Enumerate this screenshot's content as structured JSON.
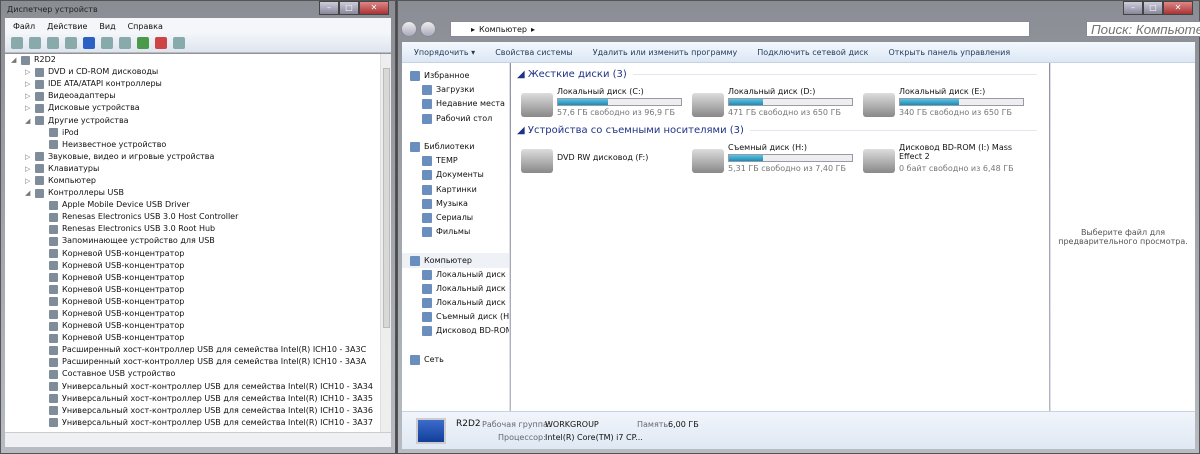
{
  "device_manager": {
    "title": "Диспетчер устройств",
    "menu": [
      "Файл",
      "Действие",
      "Вид",
      "Справка"
    ],
    "tree": [
      {
        "label": "R2D2",
        "level": 0,
        "arrow": "◢"
      },
      {
        "label": "DVD и CD-ROM дисководы",
        "level": 1,
        "arrow": "▷"
      },
      {
        "label": "IDE ATA/ATAPI контроллеры",
        "level": 1,
        "arrow": "▷"
      },
      {
        "label": "Видеоадаптеры",
        "level": 1,
        "arrow": "▷"
      },
      {
        "label": "Дисковые устройства",
        "level": 1,
        "arrow": "▷"
      },
      {
        "label": "Другие устройства",
        "level": 1,
        "arrow": "◢"
      },
      {
        "label": "iPod",
        "level": 2,
        "arrow": ""
      },
      {
        "label": "Неизвестное устройство",
        "level": 2,
        "arrow": ""
      },
      {
        "label": "Звуковые, видео и игровые устройства",
        "level": 1,
        "arrow": "▷"
      },
      {
        "label": "Клавиатуры",
        "level": 1,
        "arrow": "▷"
      },
      {
        "label": "Компьютер",
        "level": 1,
        "arrow": "▷"
      },
      {
        "label": "Контроллеры USB",
        "level": 1,
        "arrow": "◢"
      },
      {
        "label": "Apple Mobile Device USB Driver",
        "level": 2,
        "arrow": ""
      },
      {
        "label": "Renesas Electronics USB 3.0 Host Controller",
        "level": 2,
        "arrow": ""
      },
      {
        "label": "Renesas Electronics USB 3.0 Root Hub",
        "level": 2,
        "arrow": ""
      },
      {
        "label": "Запоминающее устройство для USB",
        "level": 2,
        "arrow": ""
      },
      {
        "label": "Корневой USB-концентратор",
        "level": 2,
        "arrow": ""
      },
      {
        "label": "Корневой USB-концентратор",
        "level": 2,
        "arrow": ""
      },
      {
        "label": "Корневой USB-концентратор",
        "level": 2,
        "arrow": ""
      },
      {
        "label": "Корневой USB-концентратор",
        "level": 2,
        "arrow": ""
      },
      {
        "label": "Корневой USB-концентратор",
        "level": 2,
        "arrow": ""
      },
      {
        "label": "Корневой USB-концентратор",
        "level": 2,
        "arrow": ""
      },
      {
        "label": "Корневой USB-концентратор",
        "level": 2,
        "arrow": ""
      },
      {
        "label": "Корневой USB-концентратор",
        "level": 2,
        "arrow": ""
      },
      {
        "label": "Расширенный хост-контроллер USB для семейства Intel(R) ICH10 - 3A3C",
        "level": 2,
        "arrow": ""
      },
      {
        "label": "Расширенный хост-контроллер USB для семейства Intel(R) ICH10 - 3A3A",
        "level": 2,
        "arrow": ""
      },
      {
        "label": "Составное USB устройство",
        "level": 2,
        "arrow": ""
      },
      {
        "label": "Универсальный хост-контроллер USB для семейства Intel(R) ICH10 - 3A34",
        "level": 2,
        "arrow": ""
      },
      {
        "label": "Универсальный хост-контроллер USB для семейства Intel(R) ICH10 - 3A35",
        "level": 2,
        "arrow": ""
      },
      {
        "label": "Универсальный хост-контроллер USB для семейства Intel(R) ICH10 - 3A36",
        "level": 2,
        "arrow": ""
      },
      {
        "label": "Универсальный хост-контроллер USB для семейства Intel(R) ICH10 - 3A37",
        "level": 2,
        "arrow": ""
      }
    ]
  },
  "explorer": {
    "breadcrumb": "Компьютер",
    "search_placeholder": "Поиск: Компьютер",
    "commands": [
      "Упорядочить ▾",
      "Свойства системы",
      "Удалить или изменить программу",
      "Подключить сетевой диск",
      "Открыть панель управления"
    ],
    "nav": [
      {
        "label": "Избранное",
        "sub": false
      },
      {
        "label": "Загрузки",
        "sub": true
      },
      {
        "label": "Недавние места",
        "sub": true
      },
      {
        "label": "Рабочий стол",
        "sub": true
      },
      {
        "label": "",
        "sub": false
      },
      {
        "label": "Библиотеки",
        "sub": false
      },
      {
        "label": "TEMP",
        "sub": true
      },
      {
        "label": "Документы",
        "sub": true
      },
      {
        "label": "Картинки",
        "sub": true
      },
      {
        "label": "Музыка",
        "sub": true
      },
      {
        "label": "Сериалы",
        "sub": true
      },
      {
        "label": "Фильмы",
        "sub": true
      },
      {
        "label": "",
        "sub": false
      },
      {
        "label": "Компьютер",
        "sub": false,
        "selected": true
      },
      {
        "label": "Локальный диск (C:)",
        "sub": true
      },
      {
        "label": "Локальный диск (D:)",
        "sub": true
      },
      {
        "label": "Локальный диск (E:)",
        "sub": true
      },
      {
        "label": "Съемный диск (H:)",
        "sub": true
      },
      {
        "label": "Дисковод BD-ROM",
        "sub": true
      },
      {
        "label": "",
        "sub": false
      },
      {
        "label": "Сеть",
        "sub": false
      }
    ],
    "hard_disks_header": "Жесткие диски (3)",
    "removable_header": "Устройства со съемными носителями (3)",
    "hard_disks": [
      {
        "name": "Локальный диск (C:)",
        "free": "57,6 ГБ свободно из 96,9 ГБ",
        "used_fraction": 0.41
      },
      {
        "name": "Локальный диск (D:)",
        "free": "471 ГБ свободно из 650 ГБ",
        "used_fraction": 0.28
      },
      {
        "name": "Локальный диск (E:)",
        "free": "340 ГБ свободно из 650 ГБ",
        "used_fraction": 0.48
      }
    ],
    "removable": [
      {
        "name": "DVD RW дисковод (F:)"
      },
      {
        "name": "Съемный диск (H:)",
        "free": "5,31 ГБ свободно из 7,40 ГБ",
        "used_fraction": 0.28
      },
      {
        "name": "Дисковод BD-ROM (I:) Mass Effect 2",
        "free": "0 байт свободно из 6,48 ГБ"
      }
    ],
    "preview_text": "Выберите файл для предварительного просмотра.",
    "details": {
      "name": "R2D2",
      "workgroup_label": "Рабочая группа:",
      "workgroup": "WORKGROUP",
      "memory_label": "Память:",
      "memory": "6,00 ГБ",
      "cpu_label": "Процессор:",
      "cpu": "Intel(R) Core(TM) i7 CP..."
    }
  }
}
